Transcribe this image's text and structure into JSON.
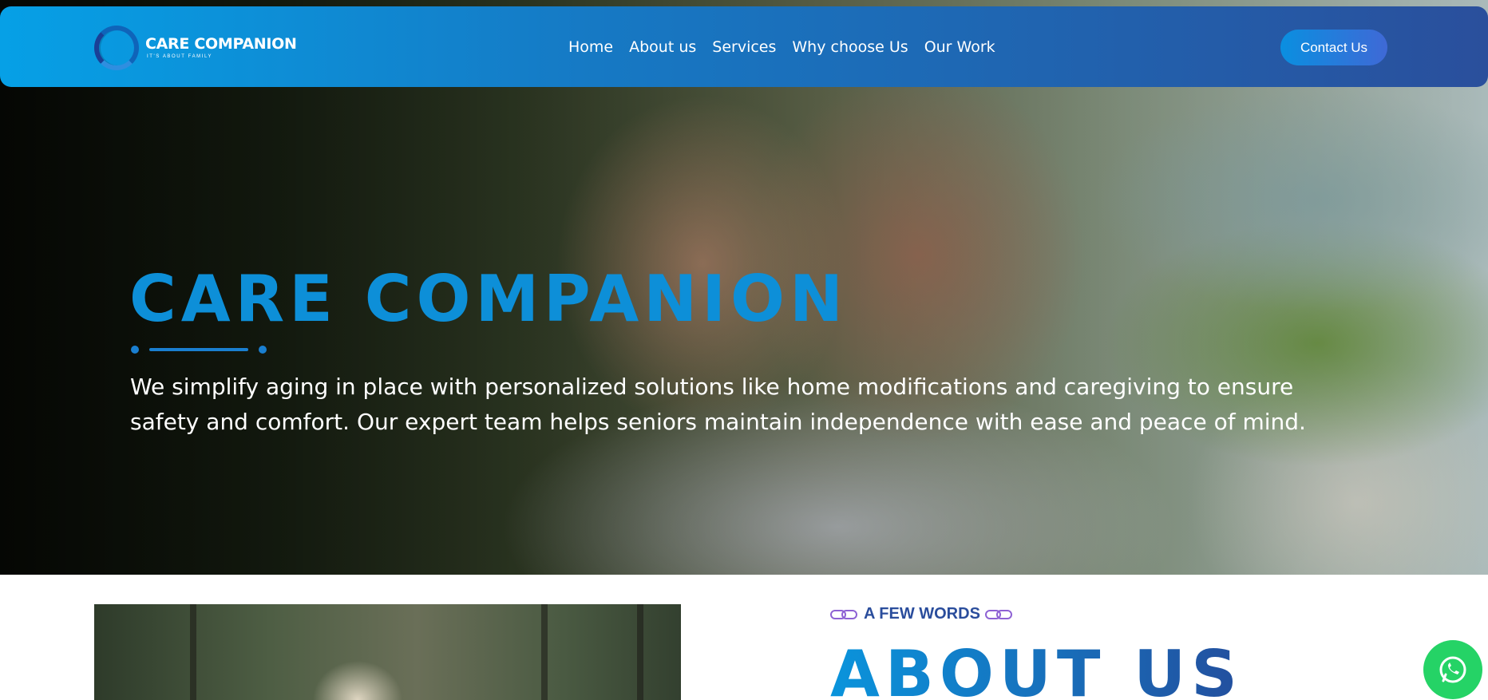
{
  "brand": {
    "name": "CARE COMPANION",
    "tagline": "IT'S ABOUT FAMILY"
  },
  "nav": {
    "items": [
      {
        "label": "Home"
      },
      {
        "label": "About us"
      },
      {
        "label": "Services"
      },
      {
        "label": "Why choose Us"
      },
      {
        "label": "Our Work"
      }
    ],
    "cta": "Contact Us"
  },
  "hero": {
    "title": "CARE COMPANION",
    "text": "We simplify aging in place with personalized solutions like home modifications and caregiving to ensure safety and comfort. Our expert team helps seniors maintain independence with ease and peace of mind."
  },
  "about": {
    "eyebrow": "A FEW WORDS",
    "title": "ABOUT US"
  },
  "icons": {
    "logo": "ring-logo-icon",
    "eyebrow": "link-icon",
    "whatsapp": "whatsapp-icon"
  },
  "colors": {
    "accent": "#0d8fd8",
    "nav_gradient_start": "#06a0e6",
    "nav_gradient_end": "#2a4f9c",
    "eyebrow": "#2a4d9c",
    "whatsapp": "#25d366"
  }
}
